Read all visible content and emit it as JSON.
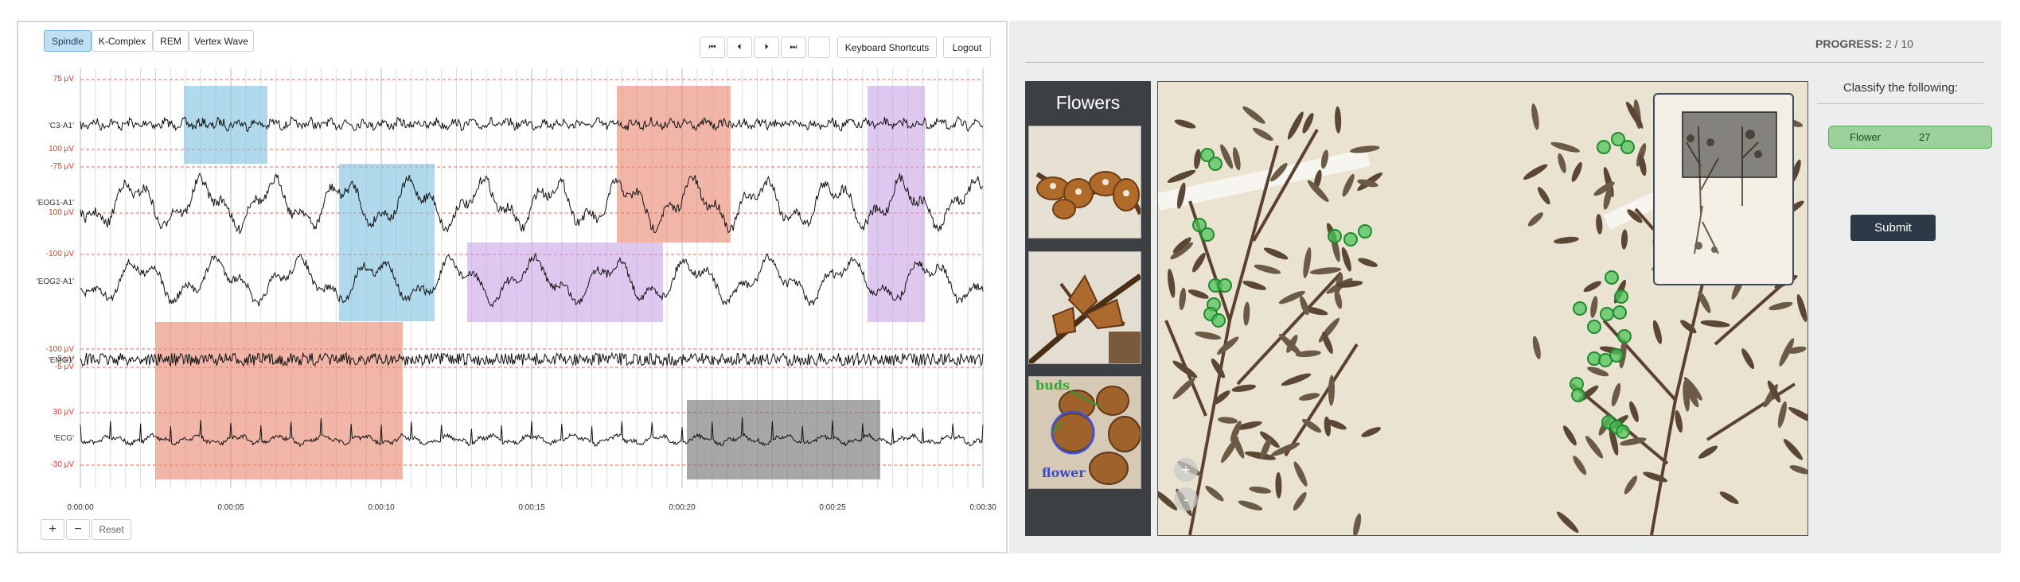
{
  "toolbar": {
    "tabs": [
      "Spindle",
      "K-Complex",
      "REM",
      "Vertex Wave"
    ],
    "keyboard_shortcuts": "Keyboard Shortcuts",
    "logout": "Logout",
    "zoom_in": "+",
    "zoom_out": "−",
    "reset": "Reset"
  },
  "eeg": {
    "y_labels": [
      "75 μV",
      "100 μV",
      "-75 μV",
      "100 μV",
      "-100 μV",
      "-100 μV",
      "5 μV",
      "-5 μV",
      "30 μV",
      "-30 μV"
    ],
    "channels": [
      "'C3-A1'",
      "'EOG1-A1'",
      "'EOG2-A1'",
      "'EMG1'",
      "'ECG'"
    ],
    "time_labels": [
      "0:00:00",
      "0:00:05",
      "0:00:10",
      "0:00:15",
      "0:00:20",
      "0:00:25",
      "0:00:30"
    ],
    "annotation_colors": {
      "spindle": "#7dbfe0",
      "kcomplex": "#e8866c",
      "rem": "#c9a3e6",
      "other": "#6d6d6d"
    }
  },
  "classify": {
    "progress_label": "PROGRESS:",
    "progress_value": "2 / 10",
    "prompt": "Classify the following:",
    "tag_label": "Flower",
    "tag_count": "27",
    "submit": "Submit"
  },
  "sidebar": {
    "title": "Flowers",
    "example_labels": [
      "buds",
      "flower"
    ]
  },
  "zoom": {
    "plus": "+",
    "minus": "-"
  }
}
